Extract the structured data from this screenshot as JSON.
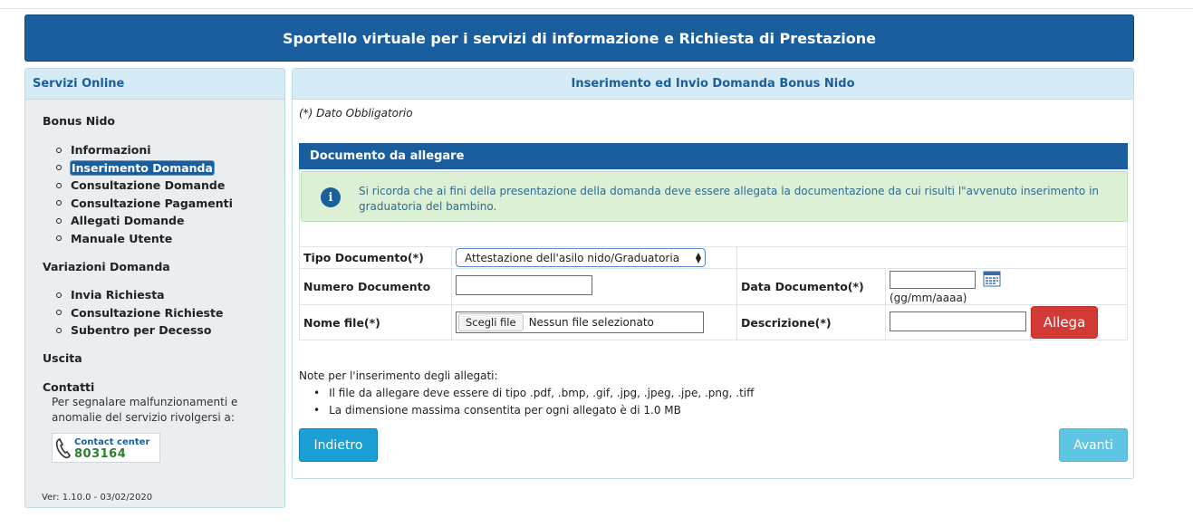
{
  "header": {
    "title": "Sportello virtuale per i servizi di informazione e Richiesta di Prestazione"
  },
  "sidebar": {
    "title": "Servizi Online",
    "sections": {
      "bonus_nido": {
        "title": "Bonus Nido",
        "items": [
          {
            "label": "Informazioni"
          },
          {
            "label": "Inserimento Domanda",
            "active": true
          },
          {
            "label": "Consultazione Domande"
          },
          {
            "label": "Consultazione Pagamenti"
          },
          {
            "label": "Allegati Domande"
          },
          {
            "label": "Manuale Utente"
          }
        ]
      },
      "variazioni": {
        "title": "Variazioni Domanda",
        "items": [
          {
            "label": "Invia Richiesta"
          },
          {
            "label": "Consultazione Richieste"
          },
          {
            "label": "Subentro per Decesso"
          }
        ]
      },
      "uscita": {
        "title": "Uscita"
      },
      "contatti": {
        "title": "Contatti",
        "text": "Per segnalare malfunzionamenti e anomalie del servizio rivolgersi a:",
        "badge_line1": "Contact center",
        "badge_line2": "803164"
      }
    },
    "version": "Ver: 1.10.0 - 03/02/2020"
  },
  "main": {
    "title": "Inserimento ed Invio Domanda Bonus Nido",
    "required_note": "(*) Dato Obbligatorio",
    "doc_section_title": "Documento da allegare",
    "alert": "Si ricorda che ai fini della presentazione della domanda deve essere allegata la documentazione da cui risulti l\"avvenuto inserimento in graduatoria del bambino.",
    "form": {
      "tipo_label": "Tipo Documento(*)",
      "tipo_value": "Attestazione dell'asilo nido/Graduatoria",
      "numero_label": "Numero Documento",
      "data_label": "Data Documento(*)",
      "data_format": "(gg/mm/aaaa)",
      "file_label": "Nome file(*)",
      "file_button": "Scegli file",
      "file_status": "Nessun file selezionato",
      "descrizione_label": "Descrizione(*)",
      "allega_button": "Allega"
    },
    "notes": {
      "title": "Note per l'inserimento degli allegati:",
      "items": [
        "Il file da allegare deve essere di tipo .pdf, .bmp, .gif, .jpg, .jpeg, .jpe, .png, .tiff",
        "La dimensione massima consentita per ogni allegato è di 1.0 MB"
      ]
    },
    "back_button": "Indietro",
    "next_button": "Avanti"
  },
  "colors": {
    "primary": "#1b5e9e",
    "panel_header": "#d5ebf6",
    "alert_bg": "#dcf0d5",
    "danger": "#d23a35",
    "back": "#1b9fd6",
    "next": "#5ec6e3"
  },
  "icons": {
    "info": "info-icon",
    "calendar": "calendar-icon",
    "phone": "phone-icon",
    "select_arrows": "chevron-updown-icon"
  }
}
